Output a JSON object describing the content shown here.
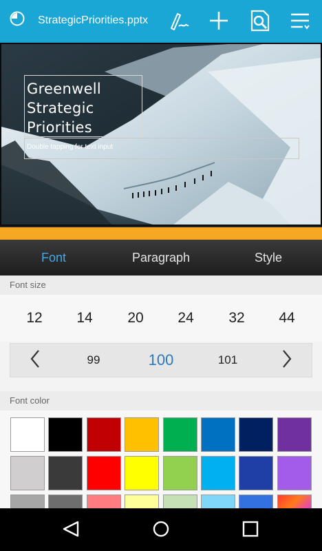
{
  "app": {
    "document_title": "StrategicPriorities.pptx"
  },
  "toolbar": {
    "icons": [
      "app-logo-icon",
      "pen-icon",
      "plus-icon",
      "find-replace-icon",
      "menu-icon"
    ]
  },
  "slide": {
    "title_lines": [
      "Greenwell",
      "Strategic",
      "Priorities"
    ],
    "subtitle_hint": "Double tapping for text input"
  },
  "tabs": [
    {
      "label": "Font",
      "active": true
    },
    {
      "label": "Paragraph",
      "active": false
    },
    {
      "label": "Style",
      "active": false
    }
  ],
  "font_size": {
    "label": "Font size",
    "presets": [
      "12",
      "14",
      "20",
      "24",
      "32",
      "44"
    ],
    "stepper": {
      "prev": "99",
      "current": "100",
      "next": "101"
    }
  },
  "font_color": {
    "label": "Font color",
    "rows": [
      [
        "#ffffff",
        "#000000",
        "#c00000",
        "#ffc000",
        "#00b050",
        "#0070c0",
        "#002060",
        "#7030a0"
      ],
      [
        "#d0cece",
        "#3a3a3a",
        "#ff0000",
        "#ffff00",
        "#92d050",
        "#00b0f0",
        "#1f3fa6",
        "#a35ce8"
      ],
      [
        "#a6a6a6",
        "#6e6e6e",
        "#ff7c80",
        "#ffff99",
        "#c5e0b4",
        "#7fd6f7",
        "#3370e0",
        "gradient"
      ]
    ]
  },
  "navigation": {
    "icons": [
      "back-icon",
      "home-icon",
      "recents-icon"
    ]
  }
}
